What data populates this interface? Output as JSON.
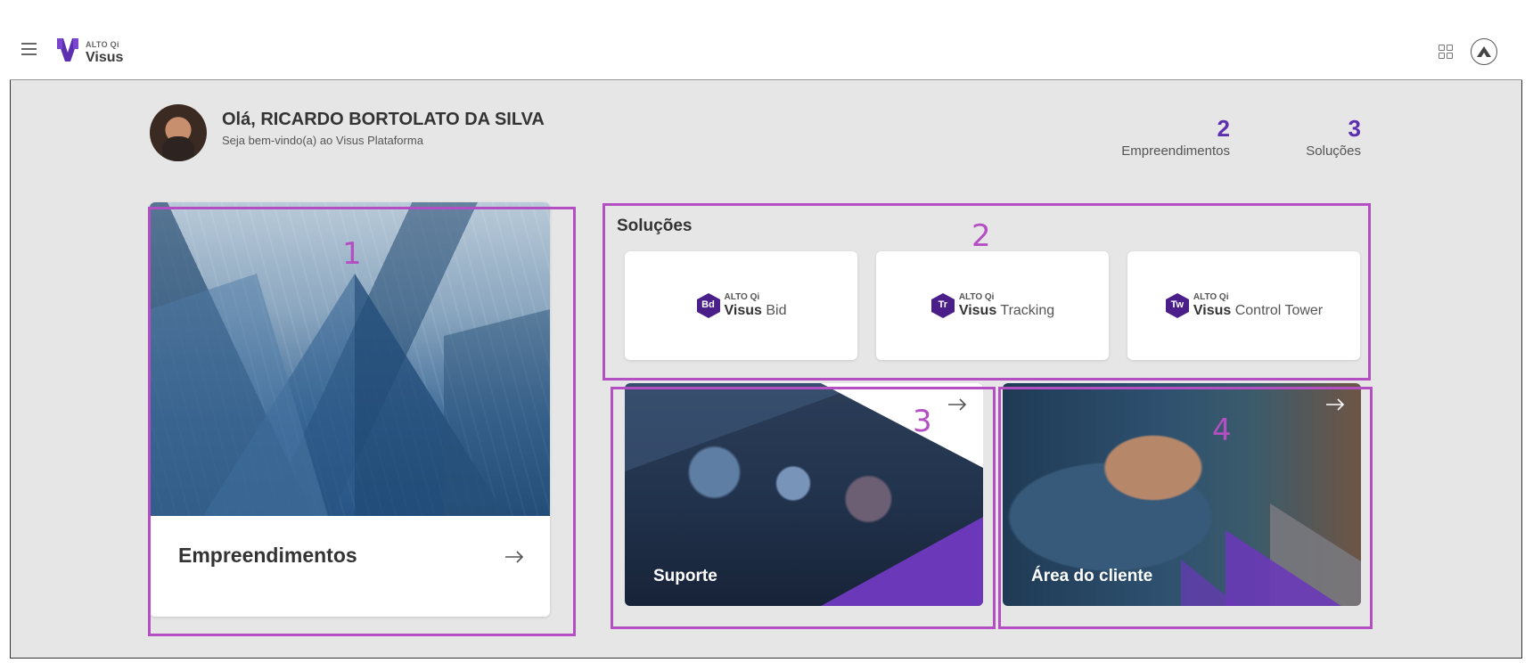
{
  "topbar": {
    "brand_small": "ALTO Qi",
    "brand_name": "Visus",
    "icons": [
      "menu-icon",
      "apps-grid-icon",
      "account-icon"
    ]
  },
  "user": {
    "greeting": "Olá, RICARDO BORTOLATO DA SILVA",
    "welcome": "Seja bem-vindo(a) ao Visus Plataforma"
  },
  "stats": [
    {
      "value": "2",
      "label": "Empreendimentos"
    },
    {
      "value": "3",
      "label": "Soluções"
    }
  ],
  "cards": {
    "empreendimentos": {
      "title": "Empreendimentos"
    },
    "suporte": {
      "title": "Suporte"
    },
    "area_cliente": {
      "title": "Área do cliente"
    }
  },
  "solutions": {
    "title": "Soluções",
    "items": [
      {
        "badge": "Bd",
        "brand": "ALTO Qi",
        "product": "Visus",
        "name": "Bid"
      },
      {
        "badge": "Tr",
        "brand": "ALTO Qi",
        "product": "Visus",
        "name": "Tracking"
      },
      {
        "badge": "Tw",
        "brand": "ALTO Qi",
        "product": "Visus",
        "name": "Control Tower"
      }
    ]
  },
  "annotations": [
    "1",
    "2",
    "3",
    "4"
  ],
  "colors": {
    "accent": "#5b2fb0",
    "highlight": "#b44fc3",
    "background": "#e6e6e6"
  }
}
